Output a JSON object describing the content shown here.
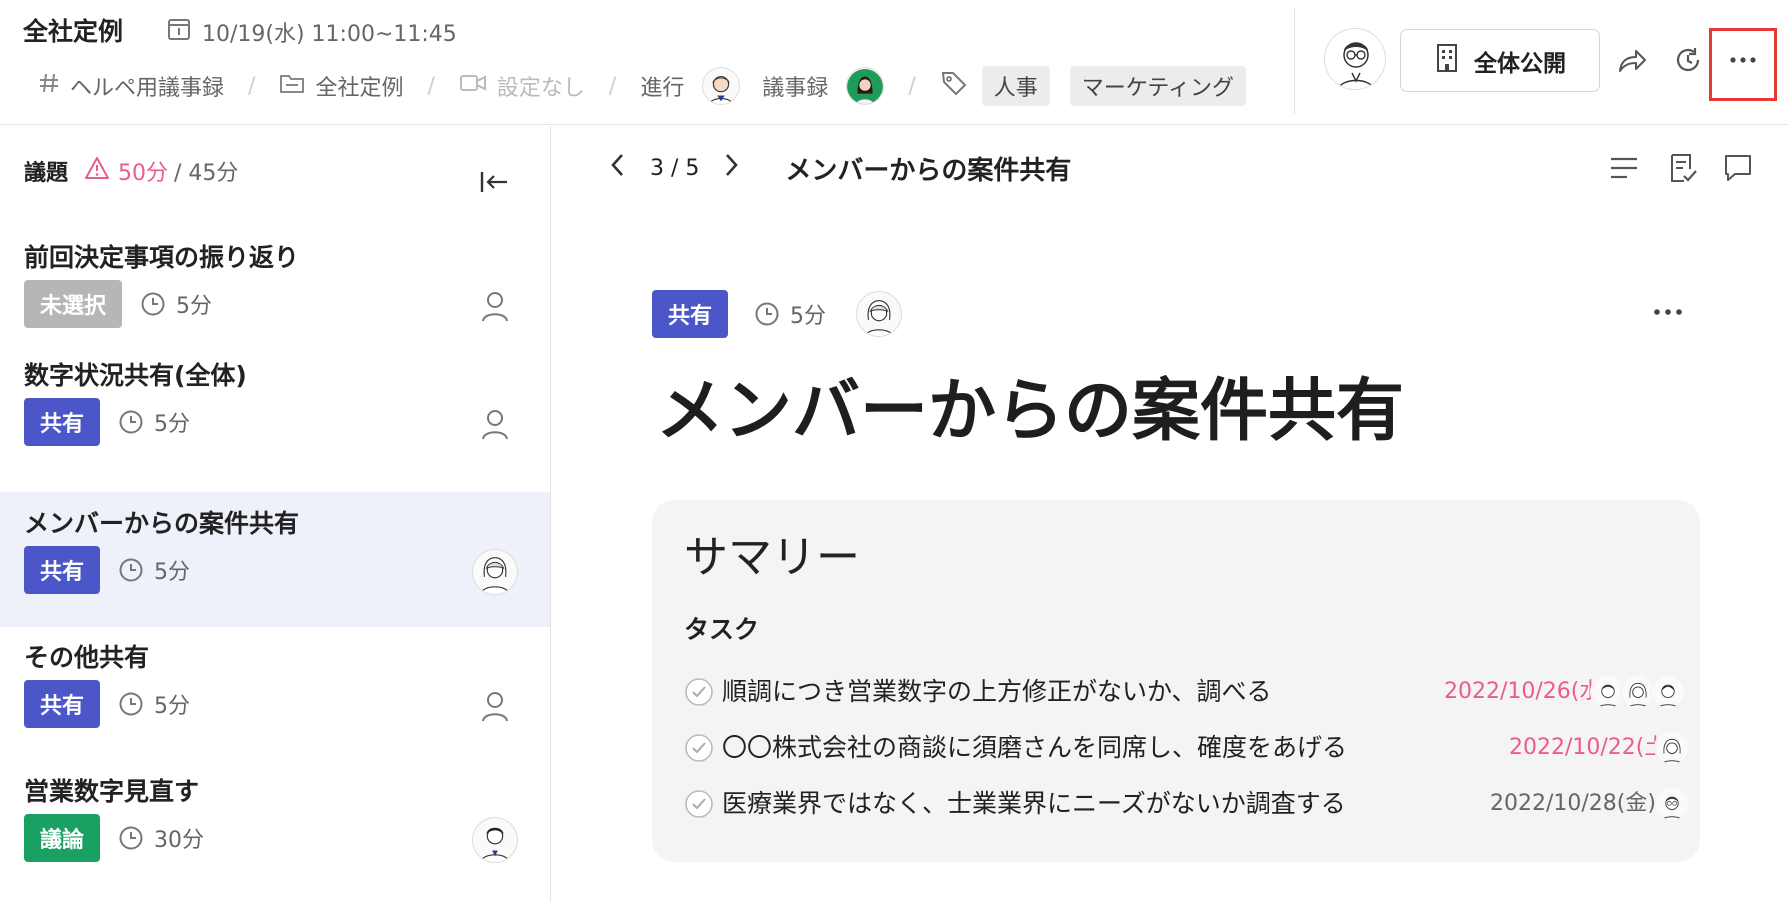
{
  "header": {
    "meeting_title": "全社定例",
    "date": "10/19(水) 11:00~11:45",
    "workspace": "ヘルペ用議事録",
    "folder": "全社定例",
    "video": "設定なし",
    "facilitator_label": "進行",
    "minutes_label": "議事録",
    "tags": [
      "人事",
      "マーケティング"
    ],
    "public_label": "全体公開"
  },
  "sidebar": {
    "label": "議題",
    "warning_time": "50分",
    "total_time": "/ 45分",
    "items": [
      {
        "title": "前回決定事項の振り返り",
        "badge": "未選択",
        "badge_color": "#b6b6b6",
        "duration": "5分"
      },
      {
        "title": "数字状況共有(全体)",
        "badge": "共有",
        "badge_color": "#4b57c9",
        "duration": "5分"
      },
      {
        "title": "メンバーからの案件共有",
        "badge": "共有",
        "badge_color": "#4b57c9",
        "duration": "5分"
      },
      {
        "title": "その他共有",
        "badge": "共有",
        "badge_color": "#4b57c9",
        "duration": "5分"
      },
      {
        "title": "営業数字見直す",
        "badge": "議論",
        "badge_color": "#1aa063",
        "duration": "30分"
      }
    ]
  },
  "main": {
    "pager": {
      "counter": "3 / 5",
      "title": "メンバーからの案件共有"
    },
    "topic": {
      "badge": "共有",
      "duration": "5分",
      "title": "メンバーからの案件共有"
    },
    "summary": {
      "title": "サマリー",
      "task_label": "タスク",
      "tasks": [
        {
          "text": "順調につき営業数字の上方修正がないか、調べる",
          "due": "2022/10/26(水)",
          "overdue": true
        },
        {
          "text": "〇〇株式会社の商談に須磨さんを同席し、確度をあげる",
          "due": "2022/10/22(土)",
          "overdue": true
        },
        {
          "text": "医療業界ではなく、士業業界にニーズがないか調査する",
          "due": "2022/10/28(金)",
          "overdue": false
        }
      ]
    }
  },
  "colors": {
    "accent_blue": "#4b57c9",
    "overdue_pink": "#ec5c8a",
    "discussion_green": "#1aa063",
    "highlight_red": "#e53935"
  }
}
